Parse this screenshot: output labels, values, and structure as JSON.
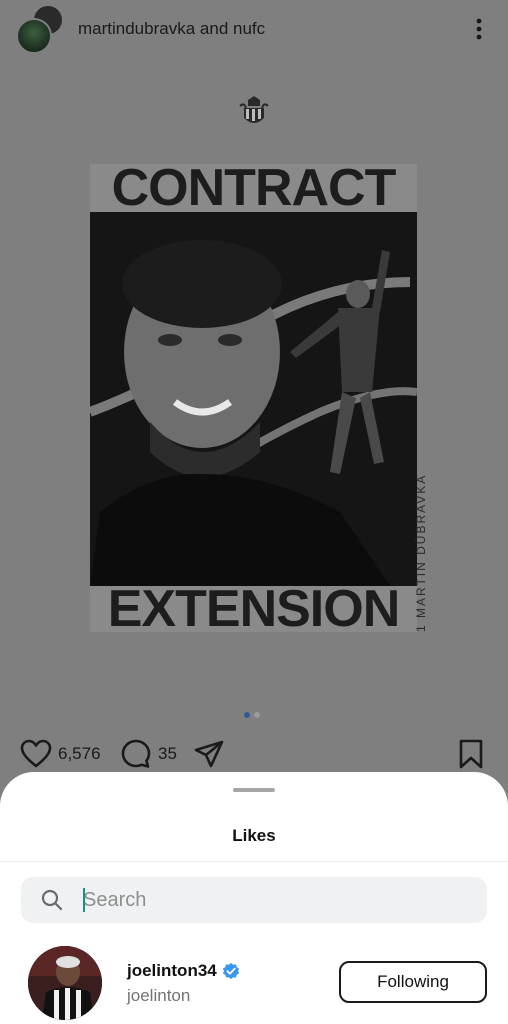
{
  "post": {
    "user_primary": "martindubravka",
    "joiner": "and",
    "user_secondary": "nufc",
    "poster_text_top": "CONTRACT",
    "poster_text_bottom": "EXTENSION",
    "poster_side_caption": "1 MARTIN DÚBRAVKA",
    "carousel": {
      "count": 2,
      "active_index": 0
    }
  },
  "actions": {
    "like_count": "6,576",
    "comment_count": "35"
  },
  "likes_sheet": {
    "title": "Likes",
    "search": {
      "placeholder": "Search",
      "value": ""
    },
    "users": [
      {
        "username": "joelinton34",
        "verified": true,
        "full_name": "joelinton",
        "follow_label": "Following"
      }
    ]
  },
  "icons": {
    "more": "more-vertical-icon",
    "like": "heart-icon",
    "comment": "comment-icon",
    "share": "send-icon",
    "save": "bookmark-icon",
    "search": "search-icon",
    "verified": "verified-badge-icon",
    "crest": "club-crest-icon"
  },
  "colors": {
    "overlay_background": "#7f7f7f",
    "sheet_background": "#ffffff",
    "verified_blue": "#3897f0",
    "active_dot": "#2f5c99"
  }
}
